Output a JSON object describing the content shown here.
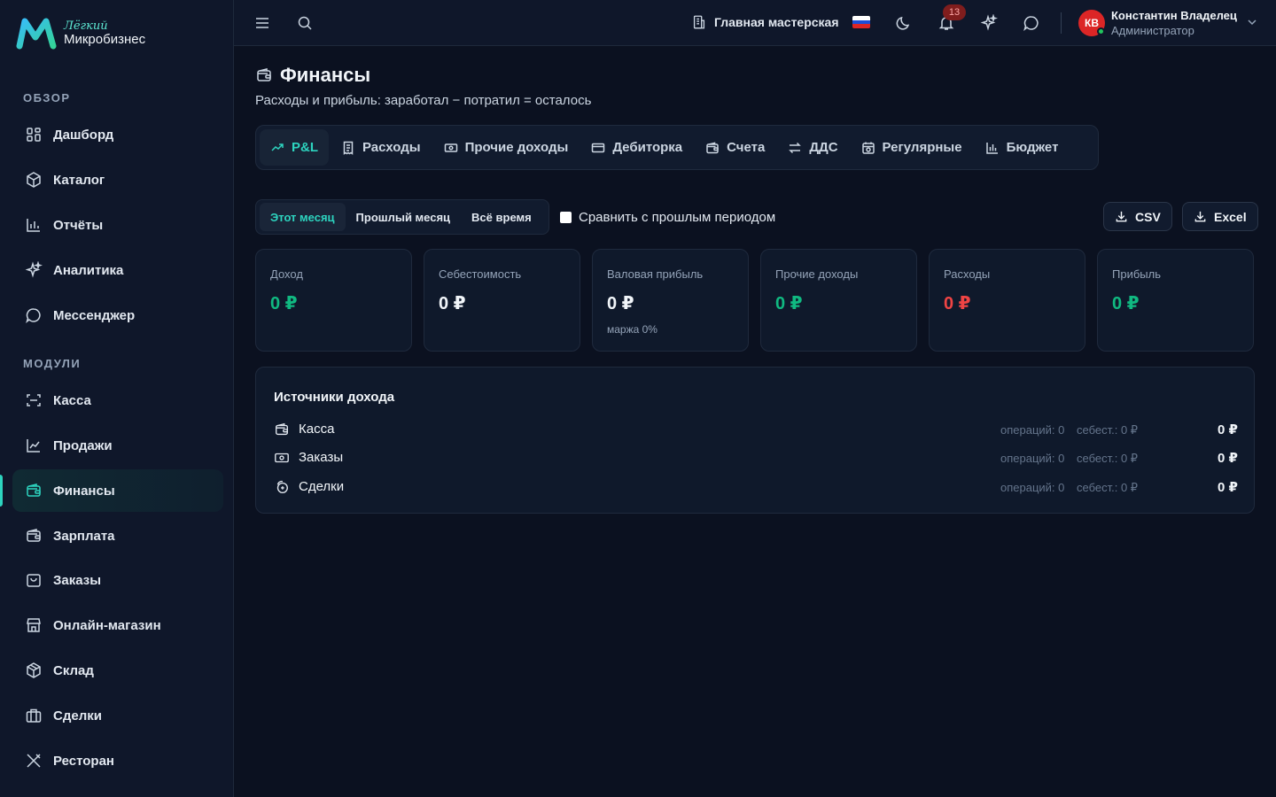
{
  "brand": {
    "tagline": "Лёгкий",
    "name": "Микробизнес"
  },
  "sidebar": {
    "section_overview": "ОБЗОР",
    "section_modules": "МОДУЛИ",
    "overview_items": [
      {
        "label": "Дашборд",
        "icon": "grid-icon"
      },
      {
        "label": "Каталог",
        "icon": "box-icon"
      },
      {
        "label": "Отчёты",
        "icon": "bar-chart-icon"
      },
      {
        "label": "Аналитика",
        "icon": "sparkles-icon"
      },
      {
        "label": "Мессенджер",
        "icon": "chat-icon"
      }
    ],
    "module_items": [
      {
        "label": "Касса",
        "icon": "scan-icon"
      },
      {
        "label": "Продажи",
        "icon": "line-chart-icon"
      },
      {
        "label": "Финансы",
        "icon": "wallet-icon",
        "active": true
      },
      {
        "label": "Зарплата",
        "icon": "wallet-icon"
      },
      {
        "label": "Заказы",
        "icon": "shopping-bag-icon"
      },
      {
        "label": "Онлайн-магазин",
        "icon": "store-icon"
      },
      {
        "label": "Склад",
        "icon": "package-icon"
      },
      {
        "label": "Сделки",
        "icon": "briefcase-icon"
      },
      {
        "label": "Ресторан",
        "icon": "utensils-icon"
      }
    ]
  },
  "topbar": {
    "workspace": "Главная мастерская",
    "notifications_count": "13",
    "user": {
      "initials": "КВ",
      "name": "Константин Владелец",
      "role": "Администратор"
    }
  },
  "page": {
    "title": "Финансы",
    "subtitle": "Расходы и прибыль: заработал − потратил = осталось"
  },
  "tabs": [
    {
      "label": "P&L",
      "icon": "trend-icon",
      "active": true
    },
    {
      "label": "Расходы",
      "icon": "receipt-icon"
    },
    {
      "label": "Прочие доходы",
      "icon": "banknote-icon"
    },
    {
      "label": "Дебиторка",
      "icon": "card-icon"
    },
    {
      "label": "Счета",
      "icon": "wallet-icon"
    },
    {
      "label": "ДДС",
      "icon": "arrows-icon"
    },
    {
      "label": "Регулярные",
      "icon": "calendar-icon"
    },
    {
      "label": "Бюджет",
      "icon": "bar-chart-icon"
    }
  ],
  "period": {
    "options": [
      "Этот месяц",
      "Прошлый месяц",
      "Всё время"
    ],
    "selected": "Этот месяц"
  },
  "compare_label": "Сравнить с прошлым периодом",
  "export": {
    "csv": "CSV",
    "excel": "Excel"
  },
  "metrics": [
    {
      "label": "Доход",
      "value": "0 ₽",
      "color": "#10b981"
    },
    {
      "label": "Себестоимость",
      "value": "0 ₽",
      "color": "#f1f5f9"
    },
    {
      "label": "Валовая прибыль",
      "value": "0 ₽",
      "color": "#f1f5f9",
      "note": "маржа 0%"
    },
    {
      "label": "Прочие доходы",
      "value": "0 ₽",
      "color": "#10b981"
    },
    {
      "label": "Расходы",
      "value": "0 ₽",
      "color": "#ef4444"
    },
    {
      "label": "Прибыль",
      "value": "0 ₽",
      "color": "#10b981"
    }
  ],
  "sources": {
    "title": "Источники дохода",
    "rows": [
      {
        "name": "Касса",
        "icon": "wallet-icon",
        "ops": "операций: 0",
        "cost": "себест.: 0 ₽",
        "value": "0 ₽"
      },
      {
        "name": "Заказы",
        "icon": "banknote-icon",
        "ops": "операций: 0",
        "cost": "себест.: 0 ₽",
        "value": "0 ₽"
      },
      {
        "name": "Сделки",
        "icon": "coins-icon",
        "ops": "операций: 0",
        "cost": "себест.: 0 ₽",
        "value": "0 ₽"
      }
    ]
  }
}
